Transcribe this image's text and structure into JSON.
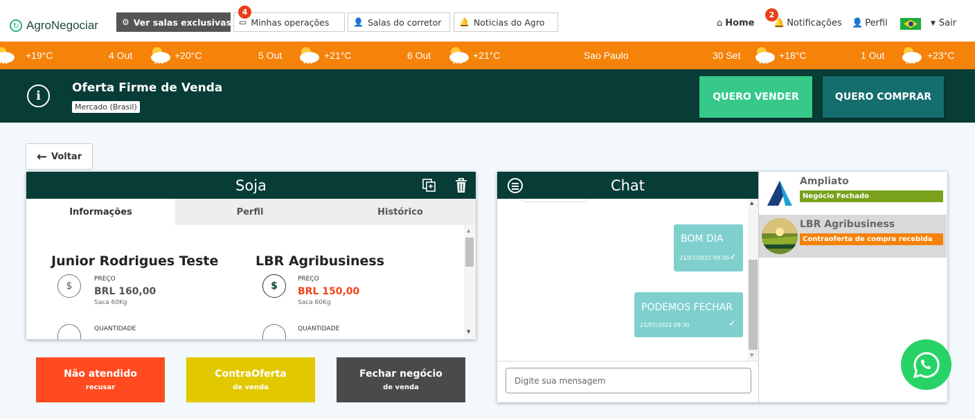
{
  "nav": {
    "brand": "AgroNegociar",
    "exclusive_rooms": "Ver salas exclusivas",
    "my_operations": "Minhas operações",
    "my_operations_badge": "4",
    "broker_rooms": "Salas do corretor",
    "news": "Noticias do Agro",
    "home": "Home",
    "notifications": "Notificações",
    "notifications_badge": "2",
    "profile": "Perfil",
    "logout": "Sair"
  },
  "ticker": [
    {
      "date": "",
      "temp": "+19°C"
    },
    {
      "date": "4 Out",
      "temp": "+20°C"
    },
    {
      "date": "5 Out",
      "temp": "+21°C"
    },
    {
      "date": "6 Out",
      "temp": "+21°C"
    },
    {
      "city": "Sao Paulo"
    },
    {
      "date": "30 Set",
      "temp": "+18°C"
    },
    {
      "date": "1 Out",
      "temp": "+23°C"
    }
  ],
  "header": {
    "title": "Oferta Firme de Venda",
    "tag": "Mercado (Brasil)",
    "sell_button": "QUERO VENDER",
    "buy_button": "QUERO COMPRAR"
  },
  "back_button": "Voltar",
  "product": {
    "title": "Soja",
    "tabs": [
      "Informações",
      "Perfil",
      "Histórico"
    ],
    "left": {
      "name": "Junior Rodrigues Teste",
      "price_label": "PREÇO",
      "price": "BRL 160,00",
      "unit": "Saca 60Kg",
      "qty_label": "QUANTIDADE"
    },
    "right": {
      "name": "LBR Agribusiness",
      "price_label": "PREÇO",
      "price": "BRL 150,00",
      "unit": "Saca 60Kg",
      "qty_label": "QUANTIDADE"
    }
  },
  "actions": [
    {
      "label": "Não atendido",
      "sub": "recusar",
      "color": "#ff4b1f"
    },
    {
      "label": "ContraOferta",
      "sub": "de venda",
      "color": "#e2c800"
    },
    {
      "label": "Fechar negócio",
      "sub": "de venda",
      "color": "#4a4a4a"
    }
  ],
  "chat": {
    "title": "Chat",
    "messages": [
      {
        "text": "BOM DIA",
        "time": "21/07/2022 09:30"
      },
      {
        "text": "PODEMOS FECHAR",
        "time": "21/07/2022 09:30"
      }
    ],
    "input_placeholder": "Digite sua mensagem",
    "contacts": [
      {
        "name": "Ampliato",
        "status": "Negócio Fechado",
        "color": "#7aa21d"
      },
      {
        "name": "LBR Agribusiness",
        "status": "Contraoferta de compra recebida",
        "color": "#f58209"
      }
    ]
  },
  "colors": {
    "primary_dark": "#083c36",
    "accent_green": "#36c98a",
    "teal": "#146e6e",
    "ticker": "#f58209",
    "whatsapp": "#27d366"
  }
}
